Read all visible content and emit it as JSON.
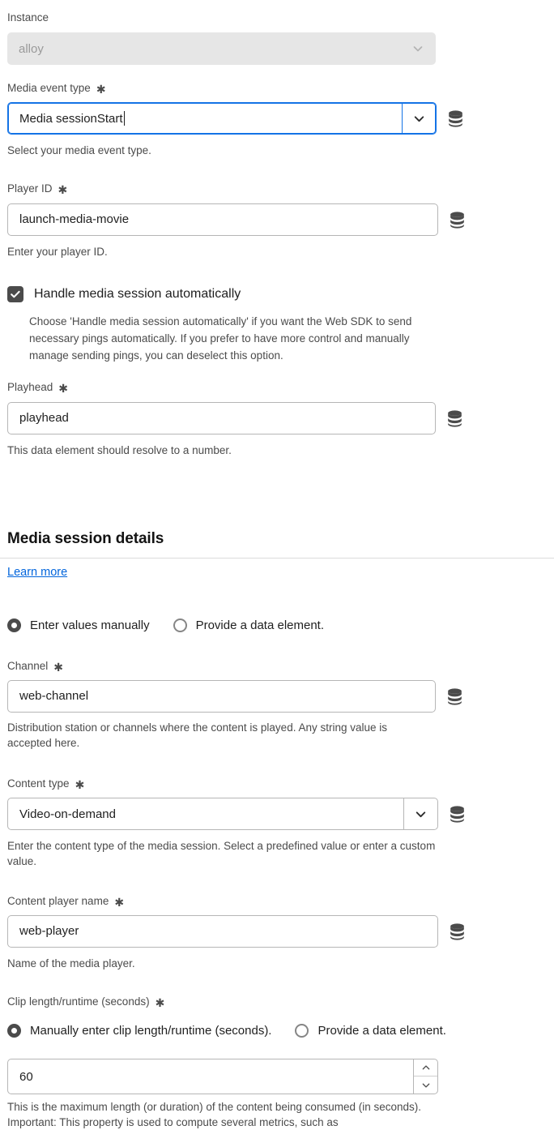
{
  "colors": {
    "focus_blue": "#1473e6",
    "link_blue": "#0265dc",
    "control_gray": "#4b4b4b",
    "border_gray": "#b6b6b6",
    "disabled_bg": "#e6e6e6"
  },
  "instance": {
    "label": "Instance",
    "value": "alloy",
    "disabled": true
  },
  "media_event_type": {
    "label": "Media event type",
    "required_marker": "✱",
    "value": "Media sessionStart",
    "help": "Select your media event type.",
    "focused": true
  },
  "player_id": {
    "label": "Player ID",
    "required_marker": "✱",
    "value": "launch-media-movie",
    "help": "Enter your player ID."
  },
  "handle_session": {
    "label": "Handle media session automatically",
    "checked": true,
    "help": "Choose 'Handle media session automatically' if you want the Web SDK to send necessary pings automatically. If you prefer to have more control and manually manage sending pings, you can deselect this option."
  },
  "playhead": {
    "label": "Playhead",
    "required_marker": "✱",
    "value": "playhead",
    "help": "This data element should resolve to a number."
  },
  "media_session_details": {
    "title": "Media session details",
    "learn_more": "Learn more",
    "value_source": {
      "manual_label": "Enter values manually",
      "data_element_label": "Provide a data element.",
      "selected": "manual"
    }
  },
  "channel": {
    "label": "Channel",
    "required_marker": "✱",
    "value": "web-channel",
    "help": "Distribution station or channels where the content is played. Any string value is accepted here."
  },
  "content_type": {
    "label": "Content type",
    "required_marker": "✱",
    "value": "Video-on-demand",
    "help": "Enter the content type of the media session. Select a predefined value or enter a custom value."
  },
  "content_player_name": {
    "label": "Content player name",
    "required_marker": "✱",
    "value": "web-player",
    "help": "Name of the media player."
  },
  "clip_length": {
    "label": "Clip length/runtime (seconds)",
    "required_marker": "✱",
    "manual_label": "Manually enter clip length/runtime (seconds).",
    "data_element_label": "Provide a data element.",
    "selected": "manual",
    "value": "60",
    "help": "This is the maximum length (or duration) of the content being consumed (in seconds). Important: This property is used to compute several metrics, such as"
  },
  "icons": {
    "data_element": "database-icon",
    "chevron_down": "chevron-down-icon",
    "chevron_up": "chevron-up-icon",
    "check": "check-icon"
  }
}
